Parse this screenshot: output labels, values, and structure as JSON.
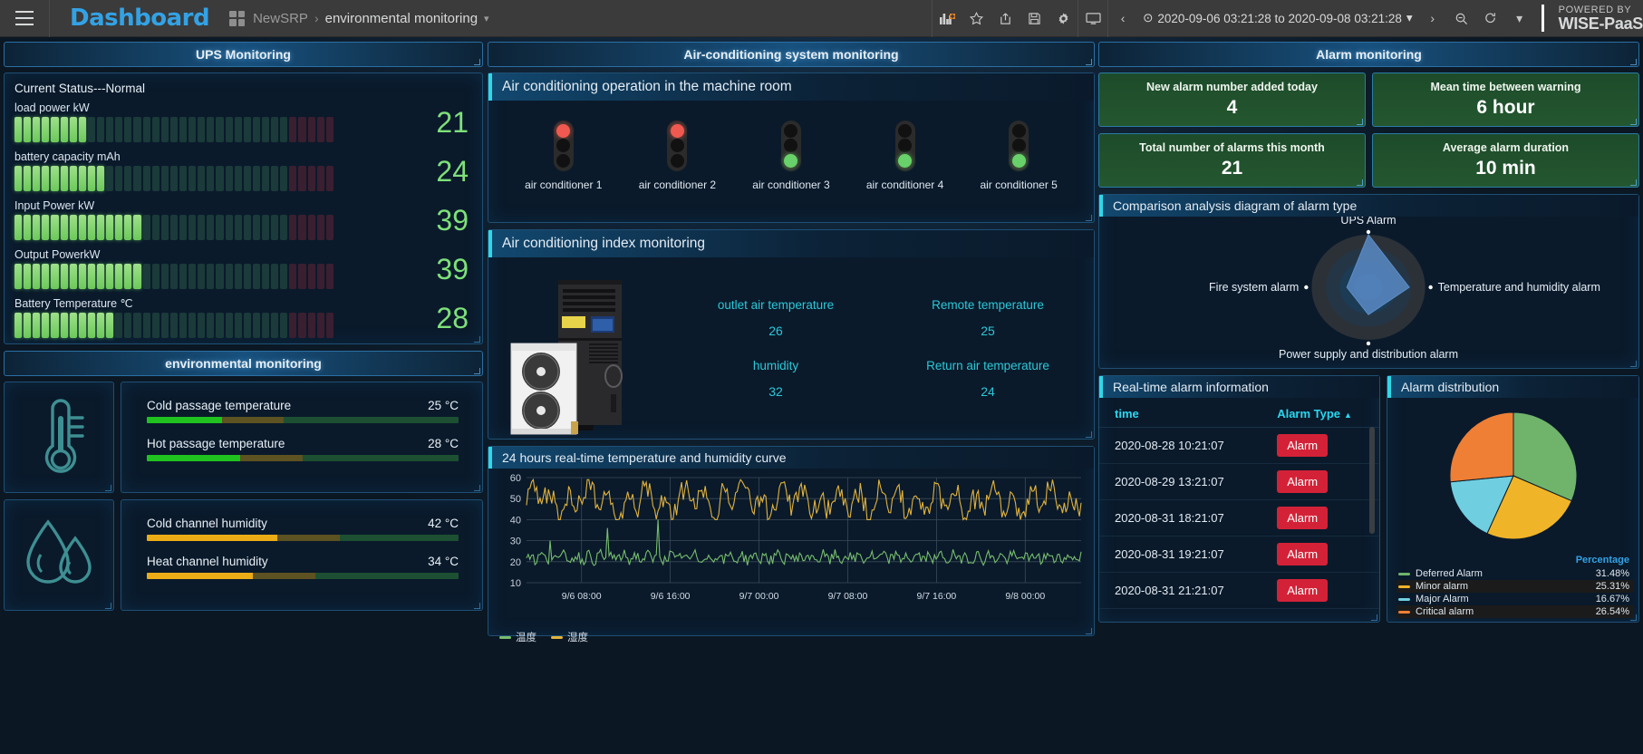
{
  "topnav": {
    "brand": "Dashboard",
    "breadcrumb_root": "NewSRP",
    "breadcrumb_sep": "›",
    "breadcrumb_current": "environmental monitoring",
    "caret": "▾",
    "timerange": "2020-09-06 03:21:28 to 2020-09-08 03:21:28",
    "clock_icon": "⊙",
    "powered_top": "POWERED BY",
    "powered_bottom": "WISE-PaaS",
    "icons": {
      "burger": "menu-icon",
      "grid": "apps-grid-icon",
      "add_panel": "add-panel-icon",
      "star": "☆",
      "share": "share-icon",
      "save": "save-icon",
      "settings": "gear-icon",
      "tv": "tv-icon",
      "prev": "‹",
      "next": "›",
      "zoom_out": "zoom-out-icon",
      "refresh": "↻",
      "refresh_caret": "▾"
    }
  },
  "ups": {
    "section_title": "UPS Monitoring",
    "status": "Current Status---Normal",
    "rows": [
      {
        "label": "load power kW",
        "value": "21",
        "filled": 8,
        "total": 35,
        "red_from": 30
      },
      {
        "label": "battery capacity mAh",
        "value": "24",
        "filled": 10,
        "total": 35,
        "red_from": 30
      },
      {
        "label": "Input Power kW",
        "value": "39",
        "filled": 14,
        "total": 35,
        "red_from": 30
      },
      {
        "label": "Output PowerkW",
        "value": "39",
        "filled": 14,
        "total": 35,
        "red_from": 30
      },
      {
        "label": "Battery Temperature ℃",
        "value": "28",
        "filled": 11,
        "total": 35,
        "red_from": 30
      }
    ]
  },
  "environmental": {
    "section_title": "environmental monitoring",
    "groups": [
      {
        "icon": "thermometer-icon",
        "lines": [
          {
            "name": "Cold passage temperature",
            "value": "25 °C",
            "pct": 24,
            "color": "#1fc21f"
          },
          {
            "name": "Hot passage temperature",
            "value": "28 °C",
            "pct": 30,
            "color": "#1fc21f"
          }
        ]
      },
      {
        "icon": "water-drops-icon",
        "lines": [
          {
            "name": "Cold channel humidity",
            "value": "42 °C",
            "pct": 42,
            "color": "#ecac16"
          },
          {
            "name": "Heat channel humidity",
            "value": "34 °C",
            "pct": 34,
            "color": "#ecac16"
          }
        ]
      }
    ]
  },
  "aircon": {
    "section_title": "Air-conditioning system monitoring",
    "operation_panel_title": "Air conditioning operation in the machine room",
    "units": [
      {
        "name": "air conditioner 1",
        "state": "red"
      },
      {
        "name": "air conditioner 2",
        "state": "red"
      },
      {
        "name": "air conditioner 3",
        "state": "green"
      },
      {
        "name": "air conditioner 4",
        "state": "green"
      },
      {
        "name": "air conditioner 5",
        "state": "green"
      }
    ],
    "index_panel_title": "Air conditioning index monitoring",
    "metrics": [
      {
        "label": "outlet air temperature",
        "value": "26"
      },
      {
        "label": "Remote temperature",
        "value": "25"
      },
      {
        "label": "humidity",
        "value": "32"
      },
      {
        "label": "Return air temperature",
        "value": "24"
      }
    ]
  },
  "alarm": {
    "section_title": "Alarm monitoring",
    "stats": [
      {
        "label": "New alarm number added today",
        "value": "4"
      },
      {
        "label": "Mean time between warning",
        "value": "6 hour"
      },
      {
        "label": "Total number of alarms this month",
        "value": "21"
      },
      {
        "label": "Average alarm duration",
        "value": "10 min"
      }
    ],
    "radar_title": "Comparison analysis diagram of alarm type",
    "table_title": "Real-time alarm information",
    "table_headers": {
      "time": "time",
      "type": "Alarm Type",
      "sort": "▲"
    },
    "rows": [
      {
        "time": "2020-08-28 10:21:07",
        "type": "Alarm"
      },
      {
        "time": "2020-08-29 13:21:07",
        "type": "Alarm"
      },
      {
        "time": "2020-08-31 18:21:07",
        "type": "Alarm"
      },
      {
        "time": "2020-08-31 19:21:07",
        "type": "Alarm"
      },
      {
        "time": "2020-08-31 21:21:07",
        "type": "Alarm"
      }
    ],
    "pie_title": "Alarm distribution",
    "pie_legend_header": "Percentage"
  },
  "chart_data": [
    {
      "type": "line",
      "title": "24 hours real-time temperature and humidity curve",
      "xlabel": "",
      "ylabel": "",
      "ylim": [
        10,
        60
      ],
      "yticks": [
        10,
        20,
        30,
        40,
        50,
        60
      ],
      "xticks": [
        "9/6 08:00",
        "9/6 16:00",
        "9/7 00:00",
        "9/7 08:00",
        "9/7 16:00",
        "9/8 00:00"
      ],
      "grid": true,
      "legend_position": "bottom-left",
      "series": [
        {
          "name": "温度",
          "color": "#77bd6d",
          "mean": 22,
          "min": 18,
          "max": 40,
          "spikes": [
            30,
            36,
            40
          ]
        },
        {
          "name": "湿度",
          "color": "#e2b33c",
          "mean": 49,
          "min": 40,
          "max": 59
        }
      ]
    },
    {
      "type": "radar",
      "title": "Comparison analysis diagram of alarm type",
      "categories": [
        "UPS Alarm",
        "Temperature and humidity alarm",
        "Power supply and distribution alarm",
        "Fire system alarm"
      ],
      "values": [
        100,
        72,
        52,
        38
      ],
      "max": 100,
      "fill": "#5b8ec9",
      "rings": 4
    },
    {
      "type": "pie",
      "title": "Alarm distribution",
      "labels": [
        "Deferred Alarm",
        "Minor alarm",
        "Major Alarm",
        "Critical alarm"
      ],
      "values": [
        31.48,
        25.31,
        16.67,
        26.54
      ],
      "display_values": [
        "31.48%",
        "25.31%",
        "16.67%",
        "26.54%"
      ],
      "colors": [
        "#70b36b",
        "#f0b429",
        "#6fcfe0",
        "#ef7f35"
      ],
      "legend_header": "Percentage"
    }
  ]
}
